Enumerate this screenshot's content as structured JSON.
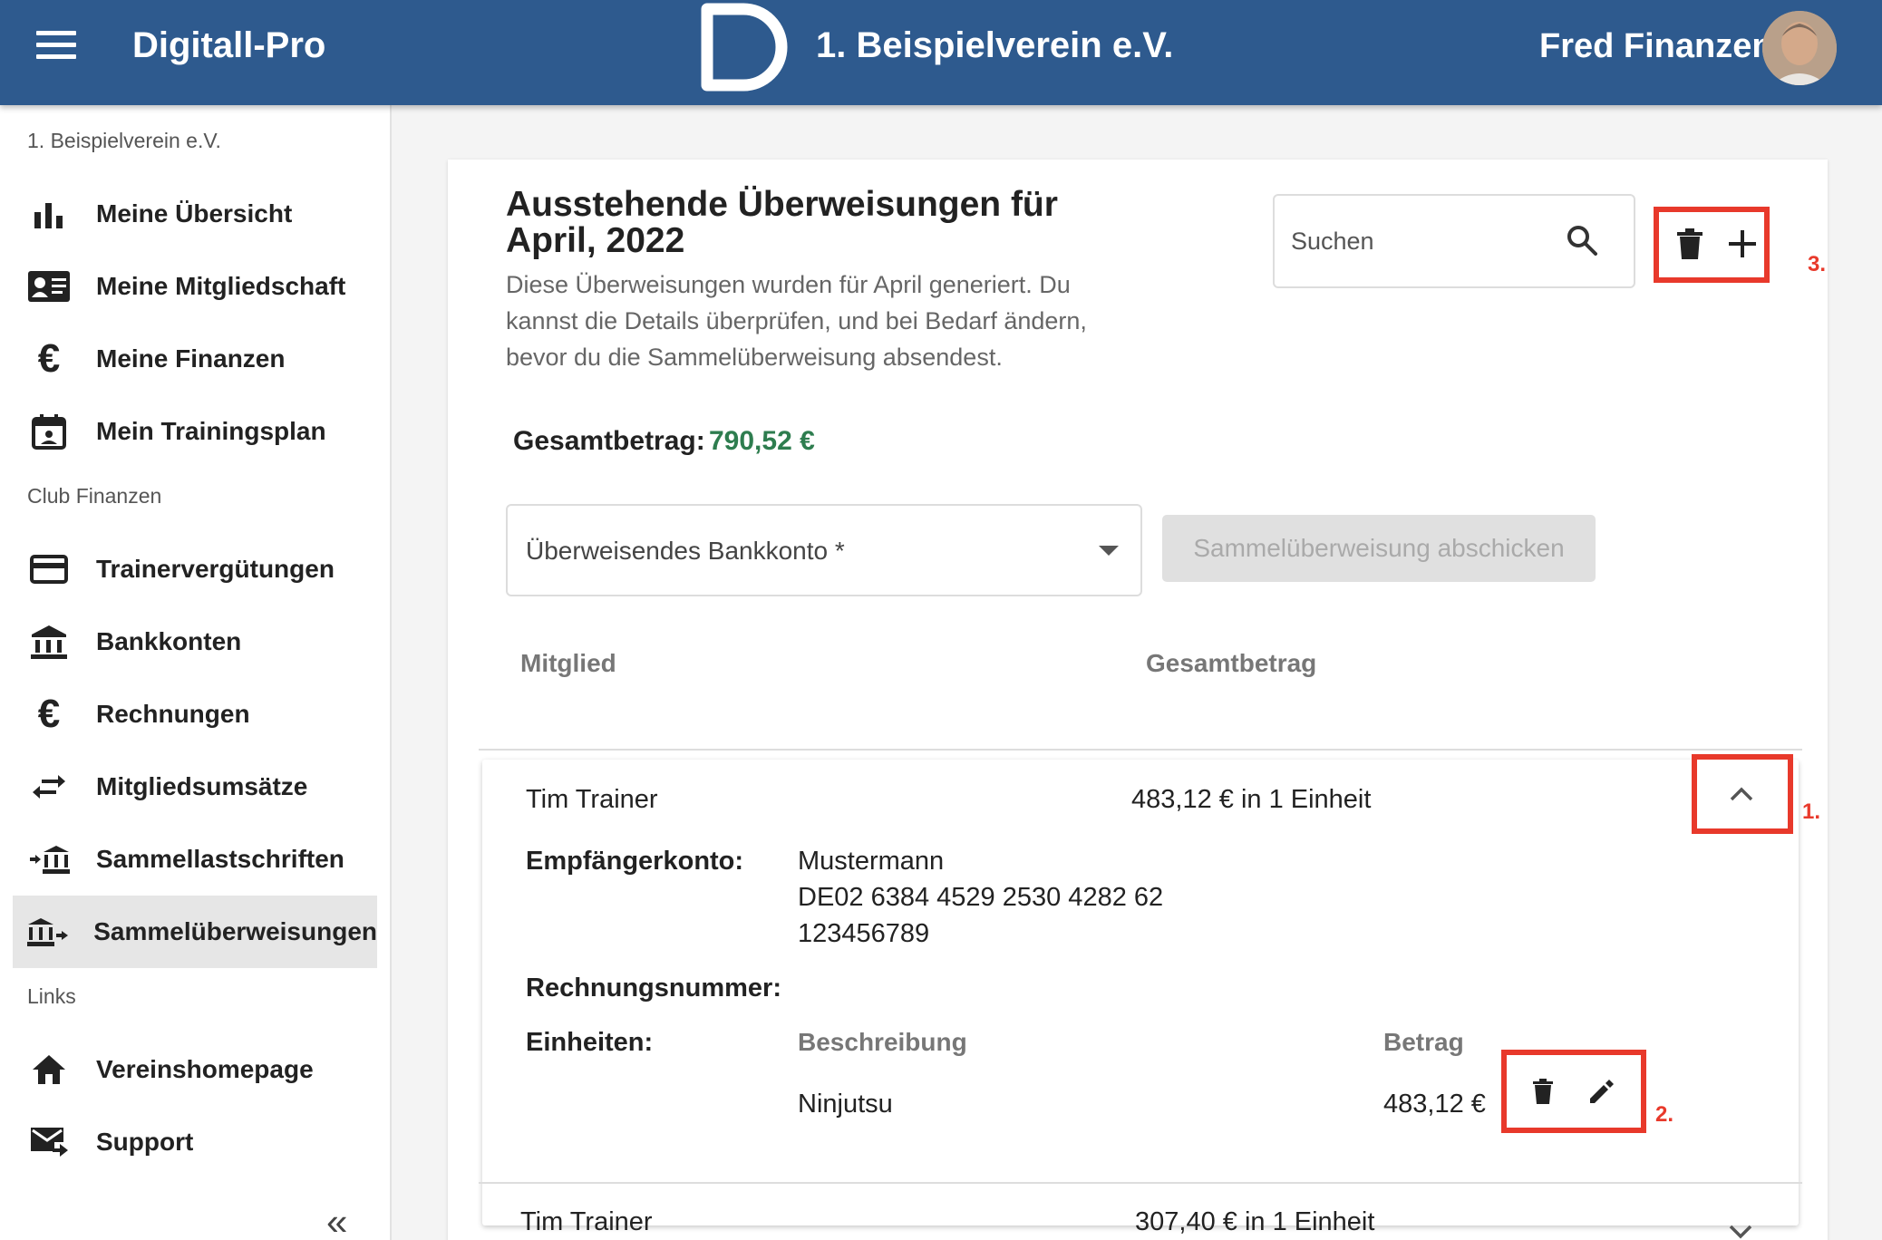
{
  "header": {
    "app_name": "Digitall-Pro",
    "org_name": "1. Beispielverein e.V.",
    "user_name": "Fred Finanzen"
  },
  "sidebar": {
    "org_label": "1. Beispielverein e.V.",
    "section_finance": "Club Finanzen",
    "section_links": "Links",
    "items": [
      {
        "label": "Meine Übersicht",
        "icon": "bar-chart-icon"
      },
      {
        "label": "Meine Mitgliedschaft",
        "icon": "id-card-icon"
      },
      {
        "label": "Meine Finanzen",
        "icon": "euro-icon"
      },
      {
        "label": "Mein Trainingsplan",
        "icon": "calendar-icon"
      },
      {
        "label": "Trainervergütungen",
        "icon": "credit-card-icon"
      },
      {
        "label": "Bankkonten",
        "icon": "bank-icon"
      },
      {
        "label": "Rechnungen",
        "icon": "euro-icon"
      },
      {
        "label": "Mitgliedsumsätze",
        "icon": "swap-arrows-icon"
      },
      {
        "label": "Sammellastschriften",
        "icon": "bank-arrow-in-icon"
      },
      {
        "label": "Sammelüberweisungen",
        "icon": "bank-arrow-out-icon",
        "active": true
      },
      {
        "label": "Vereinshomepage",
        "icon": "home-icon"
      },
      {
        "label": "Support",
        "icon": "mail-forward-icon"
      }
    ]
  },
  "main": {
    "title": "Ausstehende Überweisungen für April, 2022",
    "subtitle": "Diese Überweisungen wurden für April generiert. Du kannst die Details überprüfen, und bei Bedarf ändern, bevor du die Sammelüberweisung absendest.",
    "search_placeholder": "Suchen",
    "total_label": "Gesamtbetrag:",
    "total_value": "790,52 €",
    "bank_select_label": "Überweisendes Bankkonto *",
    "send_button": "Sammelüberweisung abschicken",
    "columns": {
      "member": "Mitglied",
      "total": "Gesamtbetrag"
    },
    "rows": [
      {
        "member": "Tim Trainer",
        "amount": "483,12 € in 1 Einheit",
        "recipient_label": "Empfängerkonto:",
        "recipient_name": "Mustermann",
        "recipient_iban": "DE02 6384 4529 2530 4282 62",
        "recipient_number": "123456789",
        "invoice_label": "Rechnungsnummer:",
        "units_label": "Einheiten:",
        "units_desc_header": "Beschreibung",
        "units_amount_header": "Betrag",
        "unit_desc": "Ninjutsu",
        "unit_amount": "483,12 €"
      },
      {
        "member": "Tim Trainer",
        "amount": "307,40 € in 1 Einheit"
      }
    ]
  },
  "annotations": {
    "n1": "1.",
    "n2": "2.",
    "n3": "3."
  },
  "colors": {
    "header": "#2e5a8e",
    "total_green": "#2e7d4f",
    "callout_red": "#e8392b"
  }
}
